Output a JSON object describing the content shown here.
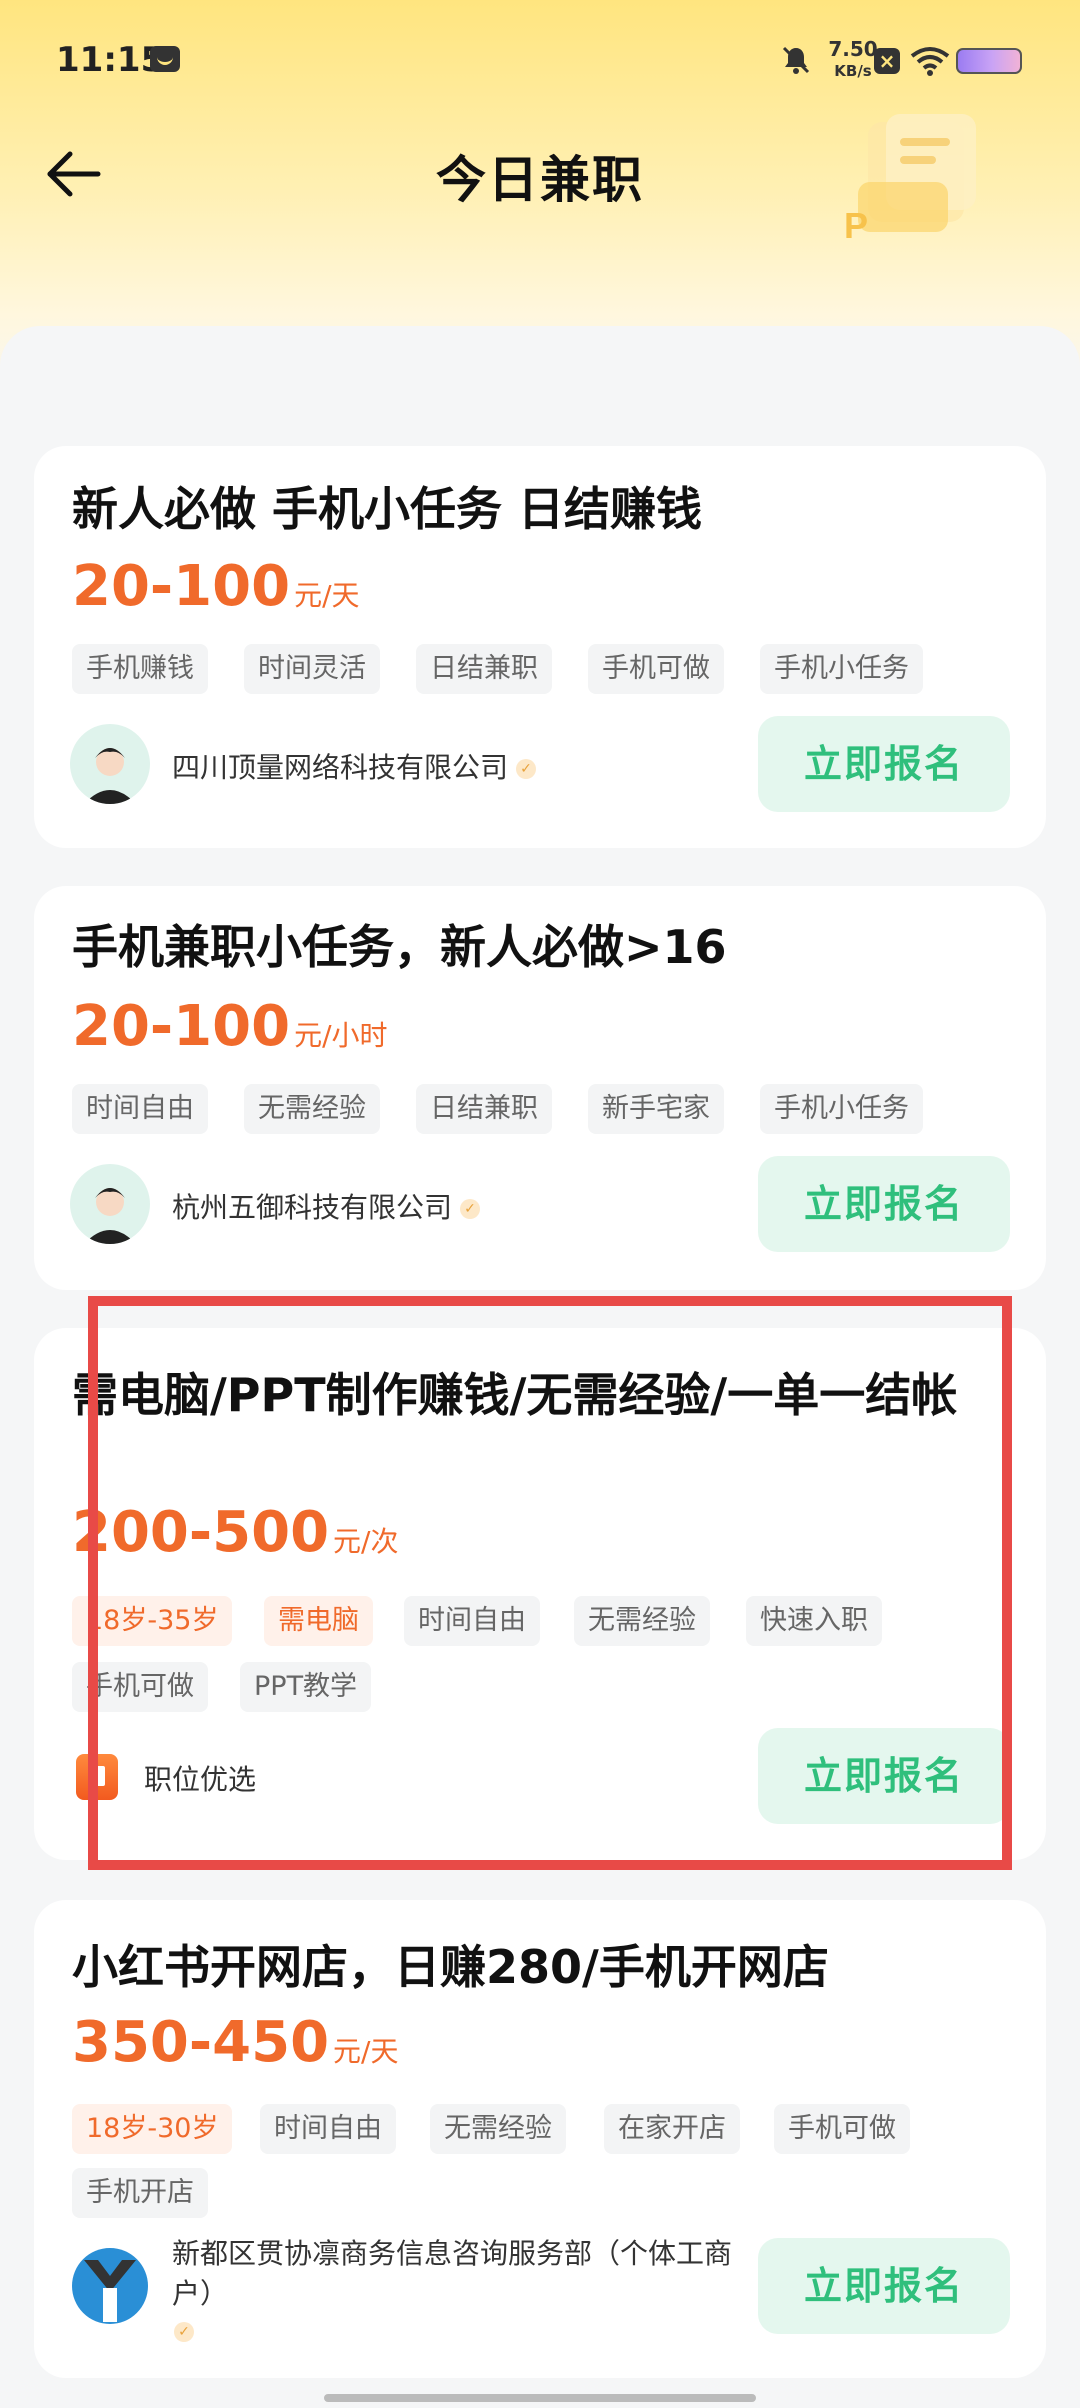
{
  "status_bar": {
    "time": "11:15",
    "speed_value": "7.50",
    "speed_unit": "KB/s"
  },
  "header": {
    "title": "今日兼职"
  },
  "colors": {
    "accent_orange": "#f06a2b",
    "apply_green": "#2fbf7c",
    "highlight_red": "#e84a47"
  },
  "jobs": [
    {
      "title": "新人必做 手机小任务 日结赚钱",
      "salary_range": "20-100",
      "salary_unit": "元/天",
      "tags": [
        "手机赚钱",
        "时间灵活",
        "日结兼职",
        "手机可做",
        "手机小任务"
      ],
      "company": "四川顶量网络科技有限公司",
      "apply_label": "立即报名"
    },
    {
      "title": "手机兼职小任务，新人必做>16",
      "salary_range": "20-100",
      "salary_unit": "元/小时",
      "tags": [
        "时间自由",
        "无需经验",
        "日结兼职",
        "新手宅家",
        "手机小任务"
      ],
      "company": "杭州五御科技有限公司",
      "apply_label": "立即报名"
    },
    {
      "title": "需电脑/PPT制作赚钱/无需经验/一单一结帐",
      "salary_range": "200-500",
      "salary_unit": "元/次",
      "tags": [
        "18岁-35岁",
        "需电脑",
        "时间自由",
        "无需经验",
        "快速入职",
        "手机可做",
        "PPT教学"
      ],
      "company": "职位优选",
      "apply_label": "立即报名"
    },
    {
      "title": "小红书开网店，日赚280/手机开网店",
      "salary_range": "350-450",
      "salary_unit": "元/天",
      "tags": [
        "18岁-30岁",
        "时间自由",
        "无需经验",
        "在家开店",
        "手机可做",
        "手机开店"
      ],
      "company": "新都区贯协凛商务信息咨询服务部（个体工商户）",
      "apply_label": "立即报名"
    }
  ]
}
